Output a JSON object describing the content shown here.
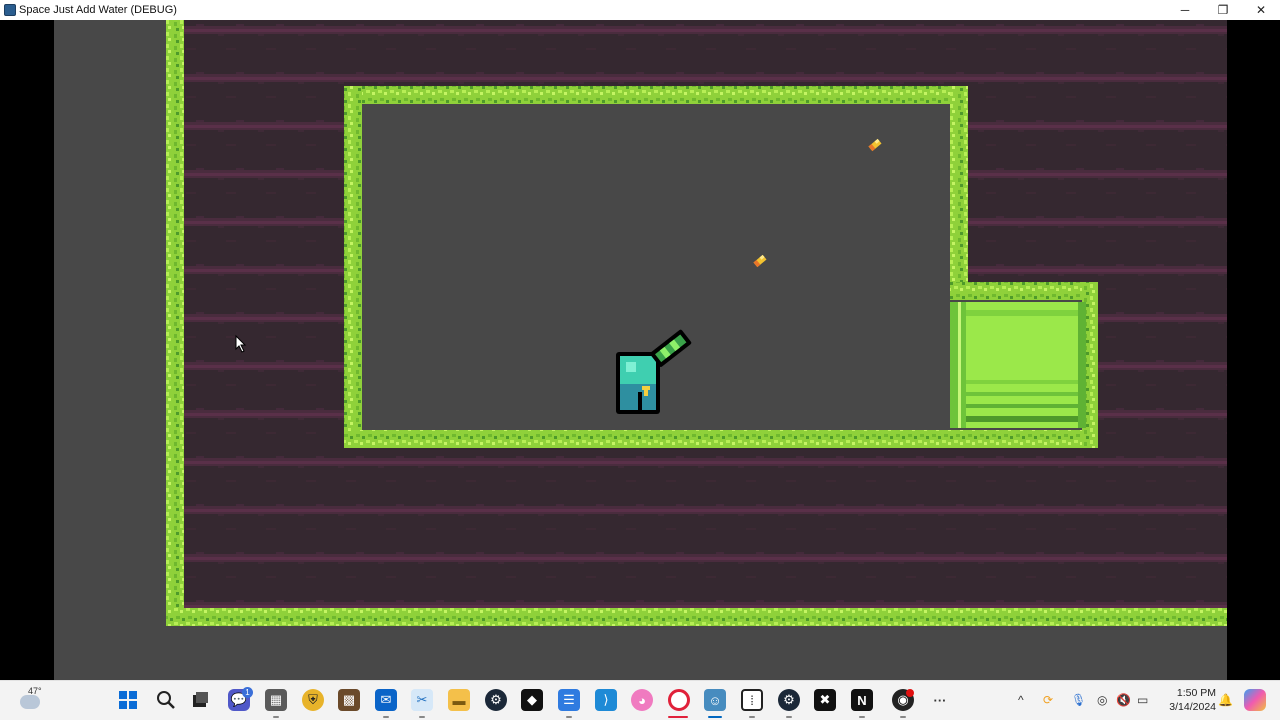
{
  "window": {
    "title": "Space Just Add Water (DEBUG)",
    "controls": {
      "minimize": "─",
      "restore": "❐",
      "close": "✕"
    }
  },
  "game": {
    "player": {
      "name": "astronaut-player",
      "holding": "water-blaster"
    },
    "pickups": [
      {
        "name": "gold-crystal"
      },
      {
        "name": "gold-crystal"
      }
    ],
    "exit": {
      "name": "green-exit-pipe"
    },
    "colors": {
      "floor": "#484848",
      "rock": "#3a2a34",
      "rock_stripe": "#57304a",
      "moss": "#8fd13a",
      "moss_dark": "#4e9a2a",
      "pipe": "#9be84a"
    }
  },
  "taskbar": {
    "weather": {
      "temp": "47°",
      "icon": "cloud-icon"
    },
    "apps": [
      {
        "name": "start-button",
        "icon": "windows-icon"
      },
      {
        "name": "search-button",
        "icon": "search-icon"
      },
      {
        "name": "task-view-button",
        "icon": "task-view-icon"
      },
      {
        "name": "teams-app",
        "icon": "chat-icon",
        "badge": "1"
      },
      {
        "name": "calculator-app",
        "icon": "calculator-icon"
      },
      {
        "name": "app-shield",
        "icon": "shield-icon"
      },
      {
        "name": "minecraft-app",
        "icon": "minecraft-icon"
      },
      {
        "name": "outlook-app",
        "icon": "outlook-icon"
      },
      {
        "name": "snipping-tool-app",
        "icon": "snip-icon"
      },
      {
        "name": "file-explorer-app",
        "icon": "folder-icon"
      },
      {
        "name": "steam-app",
        "icon": "steam-icon"
      },
      {
        "name": "app-diamond",
        "icon": "diamond-icon"
      },
      {
        "name": "notepad-app",
        "icon": "notepad-icon"
      },
      {
        "name": "vscode-app",
        "icon": "vscode-icon"
      },
      {
        "name": "paint-app",
        "icon": "paint-icon"
      },
      {
        "name": "opera-app",
        "icon": "opera-icon"
      },
      {
        "name": "godot-app",
        "icon": "godot-icon"
      },
      {
        "name": "twitch-app",
        "icon": "twitch-icon"
      },
      {
        "name": "steam-app-2",
        "icon": "steam-icon"
      },
      {
        "name": "app-pixel",
        "icon": "pixel-icon"
      },
      {
        "name": "notion-app",
        "icon": "notion-icon",
        "letter": "N"
      },
      {
        "name": "obs-app",
        "icon": "record-icon"
      },
      {
        "name": "more-apps-button",
        "icon": "more-icon",
        "letter": "···"
      }
    ],
    "tray": {
      "chevron": "^"
    },
    "clock": {
      "time": "1:50 PM",
      "date": "3/14/2024"
    }
  }
}
